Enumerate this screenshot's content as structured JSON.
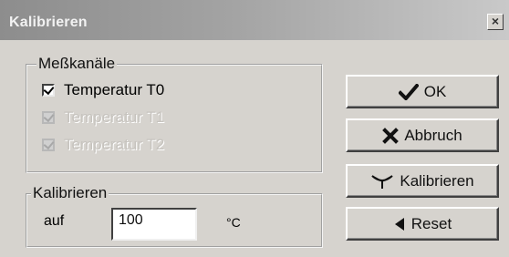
{
  "window": {
    "title": "Kalibrieren",
    "close_glyph": "×"
  },
  "channels": {
    "legend": "Meßkanäle",
    "items": [
      {
        "label": "Temperatur T0",
        "checked": true,
        "enabled": true
      },
      {
        "label": "Temperatur T1",
        "checked": true,
        "enabled": false
      },
      {
        "label": "Temperatur T2",
        "checked": true,
        "enabled": false
      }
    ]
  },
  "calibrate": {
    "legend": "Kalibrieren",
    "label": "auf",
    "value": "100",
    "unit": "°C"
  },
  "buttons": {
    "ok": {
      "label": "OK",
      "icon": "checkmark-icon"
    },
    "cancel": {
      "label": "Abbruch",
      "icon": "cross-icon"
    },
    "calibrate": {
      "label": "Kalibrieren",
      "icon": "dish-icon"
    },
    "reset": {
      "label": "Reset",
      "icon": "left-triangle-icon"
    }
  }
}
